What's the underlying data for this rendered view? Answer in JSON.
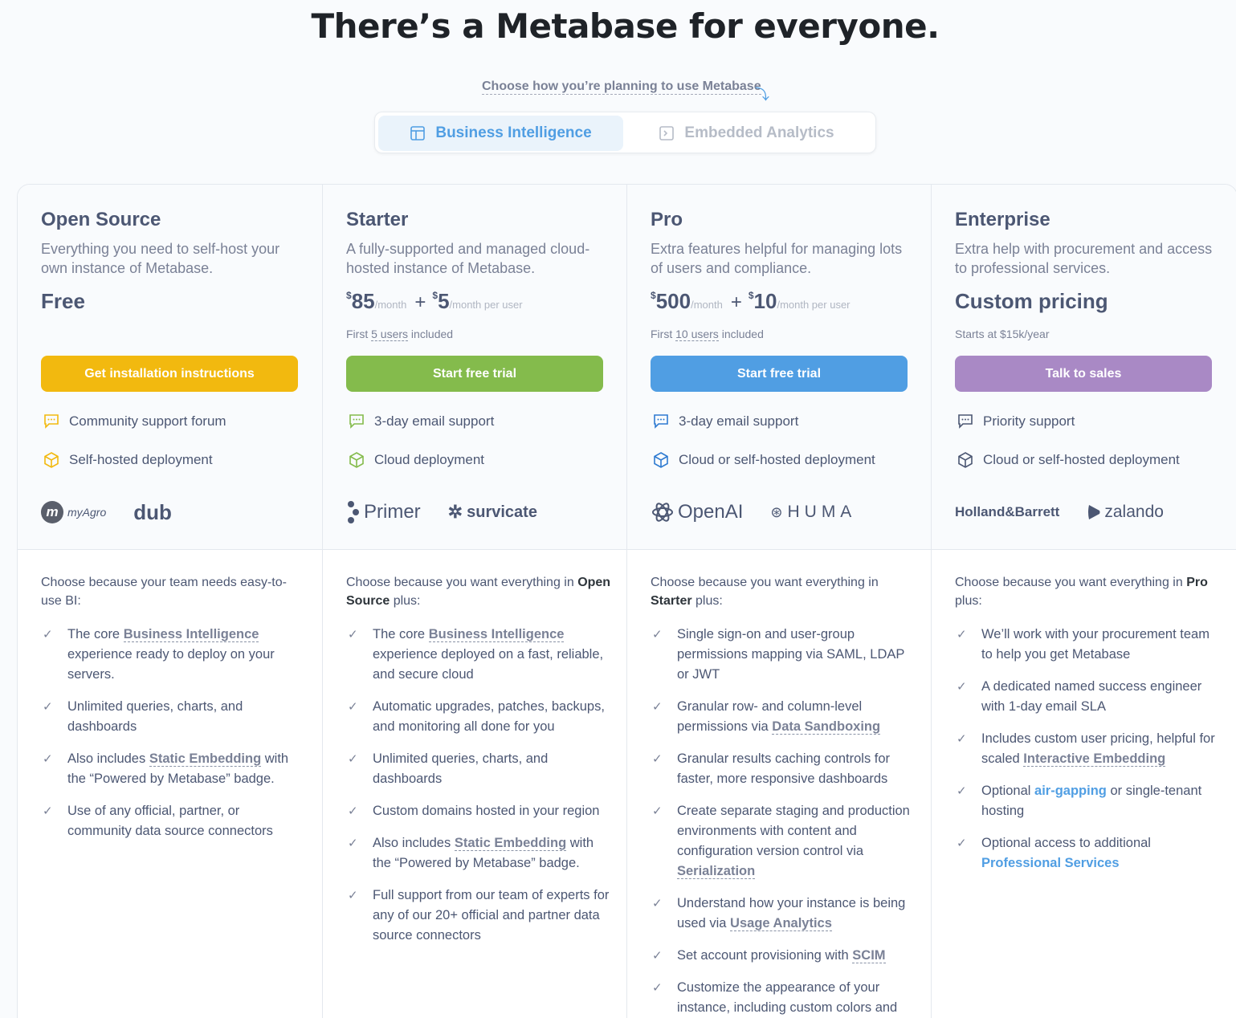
{
  "header": {
    "title": "There’s a Metabase for everyone.",
    "chooser": "Choose how you’re planning to use Metabase",
    "tabs": [
      {
        "label": "Business Intelligence",
        "icon": "layout-icon",
        "active": true
      },
      {
        "label": "Embedded Analytics",
        "icon": "terminal-icon",
        "active": false
      }
    ]
  },
  "plans": [
    {
      "name": "Open Source",
      "description": "Everything you need to self-host your own instance of Metabase.",
      "price_text": "Free",
      "cta": "Get installation instructions",
      "cta_color": "#f2b90f",
      "features": [
        "Community support forum",
        "Self-hosted deployment"
      ],
      "icon_color": "#f2b90f",
      "logos": [
        "myAgro",
        "dub"
      ],
      "why_prefix": "Choose because your team needs easy-to-use BI:",
      "bullets": {
        "b1_pre": "The core ",
        "b1_link": "Business Intelligence",
        "b1_post": " experience ready to deploy on your servers.",
        "b2": "Unlimited queries, charts, and dashboards",
        "b3_pre": "Also includes ",
        "b3_link": "Static Embedding",
        "b3_post": " with the “Powered by Metabase” badge.",
        "b4": "Use of any official, partner, or community data source connectors"
      }
    },
    {
      "name": "Starter",
      "description": "A fully-supported and managed cloud-hosted instance of Metabase.",
      "currency": "$",
      "price": "85",
      "unit": "/month",
      "plus": "+",
      "user_price": "5",
      "user_unit": "/month per user",
      "note_pre": "First ",
      "note_link": "5 users",
      "note_post": " included",
      "cta": "Start free trial",
      "cta_color": "#84bb4c",
      "features": [
        "3-day email support",
        "Cloud deployment"
      ],
      "icon_color": "#84bb4c",
      "logos": [
        "Primer",
        "survicate"
      ],
      "why_pre": "Choose because you want everything in ",
      "why_bold": "Open Source",
      "why_post": " plus:",
      "bullets": {
        "b1_pre": "The core ",
        "b1_link": "Business Intelligence",
        "b1_post": " experience deployed on a fast, reliable, and secure cloud",
        "b2": "Automatic upgrades, patches, backups, and monitoring all done for you",
        "b3": "Unlimited queries, charts, and dashboards",
        "b4": "Custom domains hosted in your region",
        "b5_pre": "Also includes ",
        "b5_link": "Static Embedding",
        "b5_post": " with the “Powered by Metabase” badge.",
        "b6": "Full support from our team of experts for any of our 20+ official and partner data source connectors"
      }
    },
    {
      "name": "Pro",
      "description": "Extra features helpful for managing lots of users and compliance.",
      "currency": "$",
      "price": "500",
      "unit": "/month",
      "plus": "+",
      "user_price": "10",
      "user_unit": "/month per user",
      "note_pre": "First ",
      "note_link": "10 users",
      "note_post": " included",
      "cta": "Start free trial",
      "cta_color": "#509ee3",
      "features": [
        "3-day email support",
        "Cloud or self-hosted deployment"
      ],
      "icon_color": "#2f7bd1",
      "logos": [
        "OpenAI",
        "HUMA"
      ],
      "why_pre": "Choose because you want everything in ",
      "why_bold": "Starter",
      "why_post": " plus:",
      "bullets": {
        "b1": "Single sign-on and user-group permissions mapping via SAML, LDAP or JWT",
        "b2_pre": "Granular row- and column-level permissions via ",
        "b2_link": "Data Sandboxing",
        "b3": "Granular results caching controls for faster, more responsive dashboards",
        "b4_pre": "Create separate staging and production environments with content and configuration version control via ",
        "b4_link": "Serialization",
        "b5_pre": "Understand how your instance is being used via ",
        "b5_link": "Usage Analytics",
        "b6_pre": "Set account provisioning with ",
        "b6_link": "SCIM",
        "b7": "Customize the appearance of your instance, including custom colors and"
      }
    },
    {
      "name": "Enterprise",
      "description": "Extra help with procurement and access to professional services.",
      "price_text": "Custom pricing",
      "note": "Starts at $15k/year",
      "cta": "Talk to sales",
      "cta_color": "#a989c5",
      "features": [
        "Priority support",
        "Cloud or self-hosted deployment"
      ],
      "icon_color": "#4c5773",
      "logos": [
        "Holland&Barrett",
        "zalando"
      ],
      "why_pre": "Choose because you want everything in ",
      "why_bold": "Pro",
      "why_post": " plus:",
      "bullets": {
        "b1": "We’ll work with your procurement team to help you get Metabase",
        "b2": "A dedicated named success engineer with 1-day email SLA",
        "b3_pre": "Includes custom user pricing, helpful for scaled ",
        "b3_link": "Interactive Embedding",
        "b4_pre": "Optional ",
        "b4_link": "air-gapping",
        "b4_post": " or single-tenant hosting",
        "b5_pre": "Optional access to additional ",
        "b5_link": "Professional Services"
      }
    }
  ]
}
